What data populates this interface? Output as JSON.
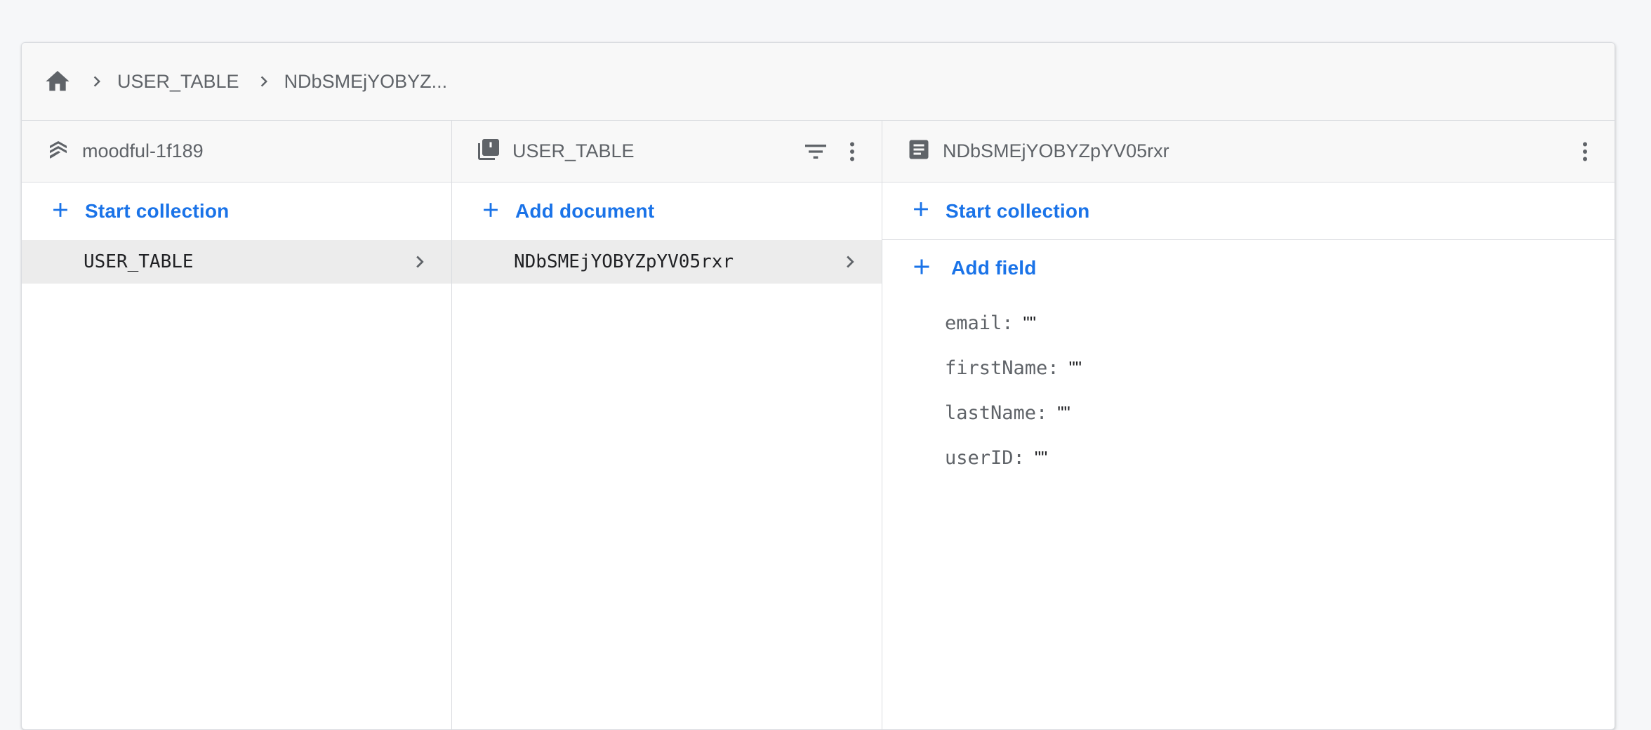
{
  "breadcrumb": {
    "home_icon": "home-icon",
    "items": [
      "USER_TABLE",
      "NDbSMEjYOBYZ..."
    ]
  },
  "columns": {
    "project": {
      "icon": "firestore-stack-icon",
      "title": "moodful-1f189",
      "action_label": "Start collection",
      "items": [
        {
          "label": "USER_TABLE"
        }
      ]
    },
    "collection": {
      "icon": "collection-icon",
      "title": "USER_TABLE",
      "action_label": "Add document",
      "items": [
        {
          "label": "NDbSMEjYOBYZpYV05rxr"
        }
      ]
    },
    "document": {
      "icon": "document-icon",
      "title": "NDbSMEjYOBYZpYV05rxr",
      "start_collection_label": "Start collection",
      "add_field_label": "Add field",
      "fields": [
        {
          "key": "email",
          "value": "\"\""
        },
        {
          "key": "firstName",
          "value": "\"\""
        },
        {
          "key": "lastName",
          "value": "\"\""
        },
        {
          "key": "userID",
          "value": "\"\""
        }
      ]
    }
  },
  "colors": {
    "accent": "#1a73e8",
    "selected_row": "#ececec",
    "header_bg": "#f8f8f8"
  }
}
